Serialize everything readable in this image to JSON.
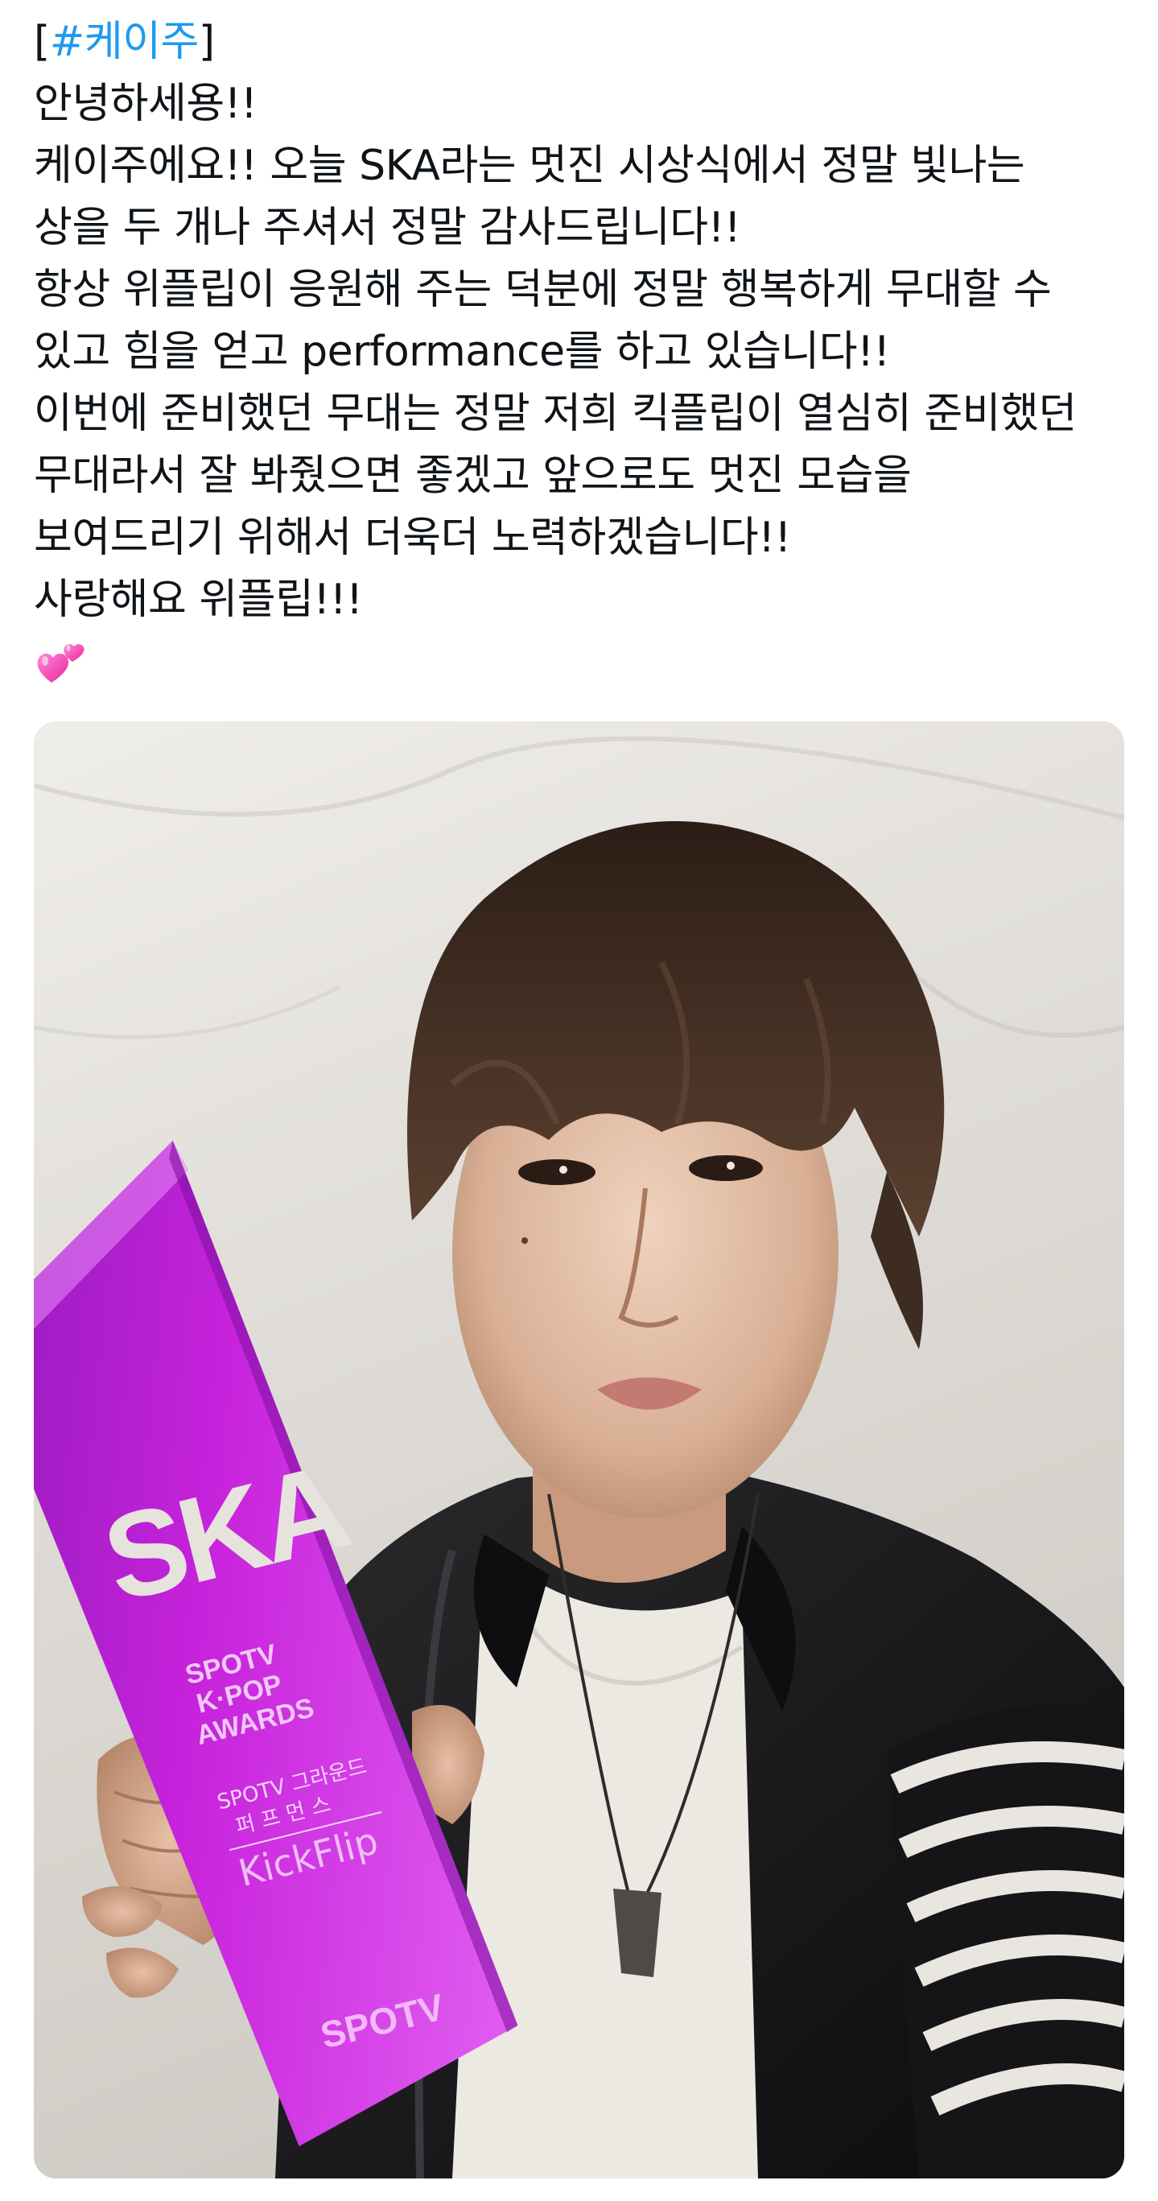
{
  "post": {
    "hashtag_open": "[",
    "hashtag": "#케이주",
    "hashtag_close": "]",
    "lines": [
      "안녕하세용!!",
      "케이주에요!! 오늘 SKA라는 멋진 시상식에서 정말 빛나는",
      "상을 두 개나 주셔서 정말 감사드립니다!!",
      "항상 위플립이 응원해 주는 덕분에 정말 행복하게 무대할 수",
      "있고 힘을 얻고 performance를 하고 있습니다!!",
      "이번에 준비했던 무대는 정말 저희 킥플립이 열심히 준비했던",
      "무대라서 잘 봐줬으면 좋겠고 앞으로도 멋진 모습을",
      "보여드리기 위해서 더욱더 노력하겠습니다!!",
      "사랑해요 위플립!!!"
    ],
    "emoji": "two-hearts-icon"
  },
  "media": {
    "trophy": {
      "logo": "SKA",
      "line1": "SPOTV",
      "line2": "K·POP",
      "line3": "AWARDS",
      "category_line1": "SPOTV 그라운드",
      "category_line2": "퍼 프 먼 스",
      "winner": "KickFlip",
      "brand": "SPOTV"
    },
    "colors": {
      "trophy": "#c21fd9",
      "trophy_light": "#e25cf0",
      "background": "#e3e1dc",
      "jacket": "#1a1a1c",
      "hair": "#3b2a20"
    }
  }
}
